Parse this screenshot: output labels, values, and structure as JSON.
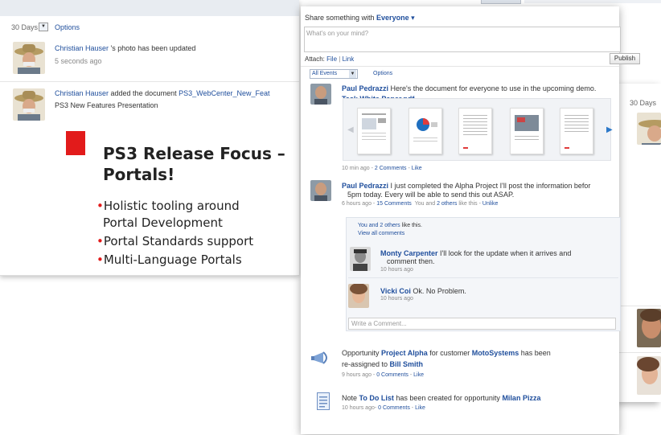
{
  "left": {
    "filter_label": "30 Days",
    "options_label": "Options",
    "items": [
      {
        "author": "Christian Hauser",
        "text": " 's photo has been updated",
        "time": "5 seconds ago"
      },
      {
        "author": "Christian Hauser",
        "text": " added the document ",
        "doc": "PS3_WebCenter_New_Feat",
        "sub": "PS3 New Features Presentation"
      }
    ],
    "slide": {
      "title1": "PS3 Release Focus –",
      "title2": "Portals!",
      "bullets": [
        "Holistic tooling around",
        "Portal Development",
        "Portal Standards support",
        "Multi-Language Portals"
      ]
    }
  },
  "center": {
    "share_label": "Share something with ",
    "share_target": "Everyone",
    "status_placeholder": "What's on your mind?",
    "attach_label": "Attach:",
    "attach_file": "File",
    "attach_sep": "|",
    "attach_link": "Link",
    "publish_label": "Publish",
    "filter_select": "All Events",
    "options_label": "Options",
    "post1": {
      "author": "Paul Pedrazzi",
      "text": " Here's the document for everyone to use in the upcoming demo.",
      "doc": "Task White Paper.pdf",
      "time": "10 min ago",
      "comments": "2 Comments",
      "like": "Like"
    },
    "post2": {
      "author": "Paul Pedrazzi",
      "text1": "  I just completed the Alpha Project I'll post the information befor",
      "text2": "5pm today. Every will be able to send this out  ASAP.",
      "time": "6 hours ago",
      "comments": "15 Comments",
      "likes_prefix": "You and ",
      "likes_others": "2 others",
      "likes_suffix": " like this",
      "unlike": "Unlike"
    },
    "comments": {
      "like_line_prefix": "You and ",
      "like_line_others": "2 others",
      "like_line_suffix": " like this.",
      "view_all": "View all comments",
      "items": [
        {
          "author": "Monty Carpenter",
          "text1": " I'll look for the update when it arrives and",
          "text2": "comment then.",
          "time": "10 hours ago"
        },
        {
          "author": "Vicki Coi",
          "text1": " Ok. No Problem.",
          "time": "10 hours ago"
        }
      ],
      "write_placeholder": "Write a Comment..."
    },
    "post3": {
      "t1": "Opportunity ",
      "link1": "Project Alpha",
      "t2": " for customer ",
      "link2": "MotoSystems",
      "t3": " has been",
      "t4": "re-assigned to ",
      "link3": "Bill Smith",
      "time": "9 hours ago",
      "comments": "0 Comments",
      "like": "Like"
    },
    "post4": {
      "t1": "Note ",
      "link1": "To Do List",
      "t2": " has been created for opportunity ",
      "link2": "Milan Pizza",
      "time": "10 hours ago",
      "comments": "0 Comments",
      "like": "Like"
    }
  },
  "back": {
    "filter_label": "30 Days"
  },
  "colors": {
    "link": "#1f4e9c",
    "slide_red": "#e21b1b",
    "publish_bg": "#eeeeee"
  }
}
